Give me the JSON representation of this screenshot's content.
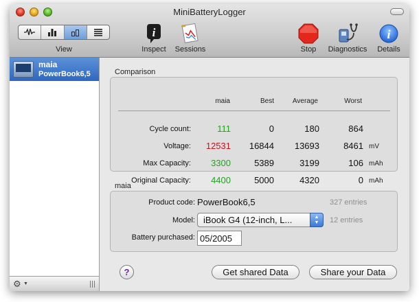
{
  "window": {
    "title": "MiniBatteryLogger"
  },
  "toolbar": {
    "view_label": "View",
    "view_modes": [
      "waveform",
      "bars",
      "bars-outline",
      "list"
    ],
    "inspect_label": "Inspect",
    "sessions_label": "Sessions",
    "stop_label": "Stop",
    "diagnostics_label": "Diagnostics",
    "details_label": "Details"
  },
  "sidebar": {
    "items": [
      {
        "name": "maia",
        "model": "PowerBook6,5"
      }
    ]
  },
  "comparison": {
    "section_title": "Comparison",
    "columns": [
      "maia",
      "Best",
      "Average",
      "Worst"
    ],
    "rows": [
      {
        "label": "Cycle count:",
        "maia": "111",
        "best": "0",
        "average": "180",
        "worst": "864",
        "unit": ""
      },
      {
        "label": "Voltage:",
        "maia": "12531",
        "best": "16844",
        "average": "13693",
        "worst": "8461",
        "unit": "mV"
      },
      {
        "label": "Max Capacity:",
        "maia": "3300",
        "best": "5389",
        "average": "3199",
        "worst": "106",
        "unit": "mAh"
      },
      {
        "label": "Original Capacity:",
        "maia": "4400",
        "best": "5000",
        "average": "4320",
        "worst": "0",
        "unit": "mAh"
      }
    ]
  },
  "details": {
    "section_title": "maia",
    "product_code_label": "Product code:",
    "product_code": "PowerBook6,5",
    "product_entries": "327 entries",
    "model_label": "Model:",
    "model_value": "iBook G4 (12-inch, L...",
    "model_entries": "12 entries",
    "purchased_label": "Battery purchased:",
    "purchased_value": "05/2005"
  },
  "actions": {
    "help": "?",
    "get_shared": "Get shared Data",
    "share": "Share your Data"
  },
  "colors": {
    "good": "#22a31e",
    "bad": "#c7121a",
    "selection": "#3d74c8"
  }
}
